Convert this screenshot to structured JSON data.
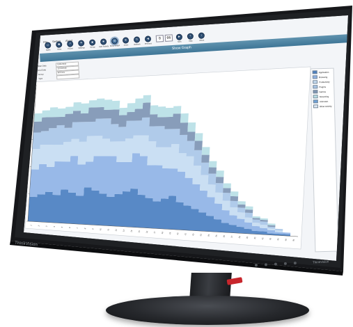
{
  "brand": "ThinkVision",
  "model": "ThinkVision",
  "app": {
    "title": "",
    "menu": [
      "File",
      "Setting",
      "About"
    ],
    "toolbar": [
      {
        "label": "Open",
        "icon": "folder-icon"
      },
      {
        "label": "Save",
        "icon": "save-icon"
      },
      {
        "label": "Export",
        "icon": "export-icon"
      },
      {
        "label": "Settings",
        "icon": "gear-icon"
      },
      {
        "label": "Group",
        "icon": "group-icon"
      },
      {
        "label": "User Activity",
        "icon": "user-icon"
      },
      {
        "label": "Show Graph",
        "icon": "graph-icon",
        "active": true
      },
      {
        "label": "Zoom",
        "icon": "zoom-icon"
      },
      {
        "label": "Refresh",
        "icon": "refresh-icon"
      },
      {
        "label": "Previous",
        "icon": "prev-icon"
      },
      {
        "label": "Next",
        "icon": "next-icon"
      },
      {
        "label": "Help",
        "icon": "help-icon"
      },
      {
        "label": "About",
        "icon": "info-icon"
      }
    ],
    "counter_left": "0",
    "counter_right": "06",
    "header_caption": "Show Graph",
    "props": [
      {
        "key": "Start Date",
        "value": "01/01/2018"
      },
      {
        "key": "End Date",
        "value": "12/31/2018"
      },
      {
        "key": "Group",
        "value": "All Users"
      },
      {
        "key": "Type",
        "value": ""
      }
    ],
    "y_title": "Hours",
    "legend": [
      {
        "name": "Application",
        "color": "#4a7fc1"
      },
      {
        "name": "Browsing",
        "color": "#8fb3e6"
      },
      {
        "name": "Productivity",
        "color": "#c5dcf2"
      },
      {
        "name": "Plugins",
        "color": "#a9c7e8"
      },
      {
        "name": "Games",
        "color": "#7e95b4"
      },
      {
        "name": "Streaming",
        "color": "#b8e0e6"
      },
      {
        "name": "Unknown",
        "color": "#6da1d8"
      },
      {
        "name": "Other Activity",
        "color": "#dde8f4"
      }
    ]
  },
  "chart_data": {
    "type": "area",
    "x": [
      "1",
      "2",
      "3",
      "4",
      "5",
      "6",
      "7",
      "8",
      "9",
      "10",
      "11",
      "12",
      "13",
      "14",
      "15",
      "16",
      "17",
      "18",
      "19",
      "20",
      "21",
      "22",
      "23",
      "24",
      "25",
      "26",
      "27",
      "28",
      "29",
      "30",
      "31",
      "32",
      "33",
      "34",
      "35"
    ],
    "ylim": [
      0,
      100
    ],
    "grid": false,
    "legend_position": "right",
    "series": [
      {
        "name": "Application",
        "values": [
          18,
          20,
          22,
          20,
          24,
          22,
          20,
          26,
          24,
          22,
          20,
          22,
          24,
          26,
          22,
          20,
          18,
          20,
          22,
          18,
          16,
          14,
          12,
          10,
          8,
          6,
          5,
          4,
          3,
          2,
          2,
          1,
          1,
          1,
          0
        ]
      },
      {
        "name": "Browsing",
        "values": [
          20,
          22,
          18,
          24,
          20,
          26,
          22,
          18,
          24,
          26,
          28,
          22,
          20,
          24,
          26,
          22,
          24,
          20,
          18,
          20,
          18,
          16,
          14,
          12,
          10,
          8,
          6,
          5,
          4,
          3,
          2,
          2,
          1,
          1,
          0
        ]
      },
      {
        "name": "Productivity",
        "values": [
          15,
          14,
          16,
          12,
          14,
          12,
          16,
          18,
          14,
          12,
          10,
          14,
          16,
          12,
          14,
          16,
          12,
          14,
          16,
          12,
          14,
          12,
          10,
          8,
          7,
          6,
          5,
          4,
          3,
          2,
          2,
          1,
          1,
          0,
          0
        ]
      },
      {
        "name": "Plugins",
        "values": [
          12,
          10,
          12,
          14,
          10,
          12,
          14,
          10,
          12,
          14,
          12,
          10,
          12,
          10,
          12,
          10,
          14,
          12,
          10,
          12,
          10,
          10,
          8,
          7,
          6,
          5,
          4,
          3,
          3,
          2,
          2,
          1,
          1,
          0,
          0
        ]
      },
      {
        "name": "Games",
        "values": [
          8,
          10,
          8,
          6,
          10,
          8,
          6,
          10,
          8,
          6,
          10,
          8,
          6,
          8,
          10,
          8,
          6,
          8,
          10,
          8,
          6,
          6,
          5,
          4,
          4,
          3,
          3,
          2,
          2,
          1,
          1,
          1,
          0,
          0,
          0
        ]
      },
      {
        "name": "Streaming",
        "values": [
          6,
          5,
          7,
          6,
          5,
          6,
          7,
          5,
          6,
          7,
          6,
          5,
          6,
          7,
          5,
          6,
          7,
          6,
          5,
          6,
          6,
          5,
          5,
          4,
          4,
          3,
          3,
          2,
          2,
          1,
          1,
          1,
          0,
          0,
          0
        ]
      }
    ]
  }
}
